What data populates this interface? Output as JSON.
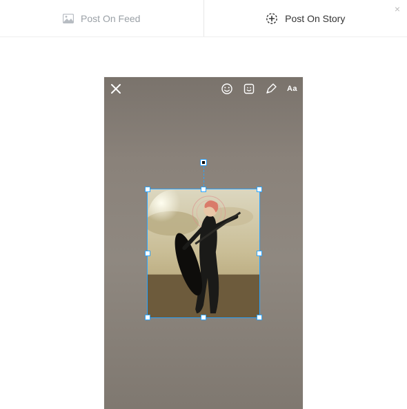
{
  "tabs": {
    "feed": {
      "label": "Post On Feed"
    },
    "story": {
      "label": "Post On Story"
    }
  },
  "close_label": "×",
  "canvas": {
    "tools": {
      "close": "close",
      "emoji": "emoji",
      "sticker": "sticker",
      "draw": "draw",
      "text_label": "Aa"
    },
    "selection": {
      "rotatable": true,
      "resizable": true
    }
  }
}
